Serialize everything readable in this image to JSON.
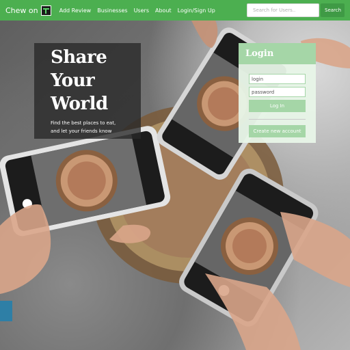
{
  "navbar": {
    "brand_text": "Chew on",
    "brand_logo_text": "it",
    "links": [
      "Add Review",
      "Businesses",
      "Users",
      "About",
      "Login/Sign Up"
    ],
    "search_placeholder": "Search for Users..",
    "search_button_label": "Search",
    "color": "#4caf50"
  },
  "hero": {
    "headline": "Share\nYour\nWorld",
    "subtext": "Find the best places to eat,\nand let your friends know"
  },
  "login": {
    "title": "Login",
    "username_placeholder": "login",
    "password_placeholder": "password",
    "login_button_label": "Log In",
    "create_account_label": "Create new account",
    "accent_color": "#a5d6a7"
  }
}
